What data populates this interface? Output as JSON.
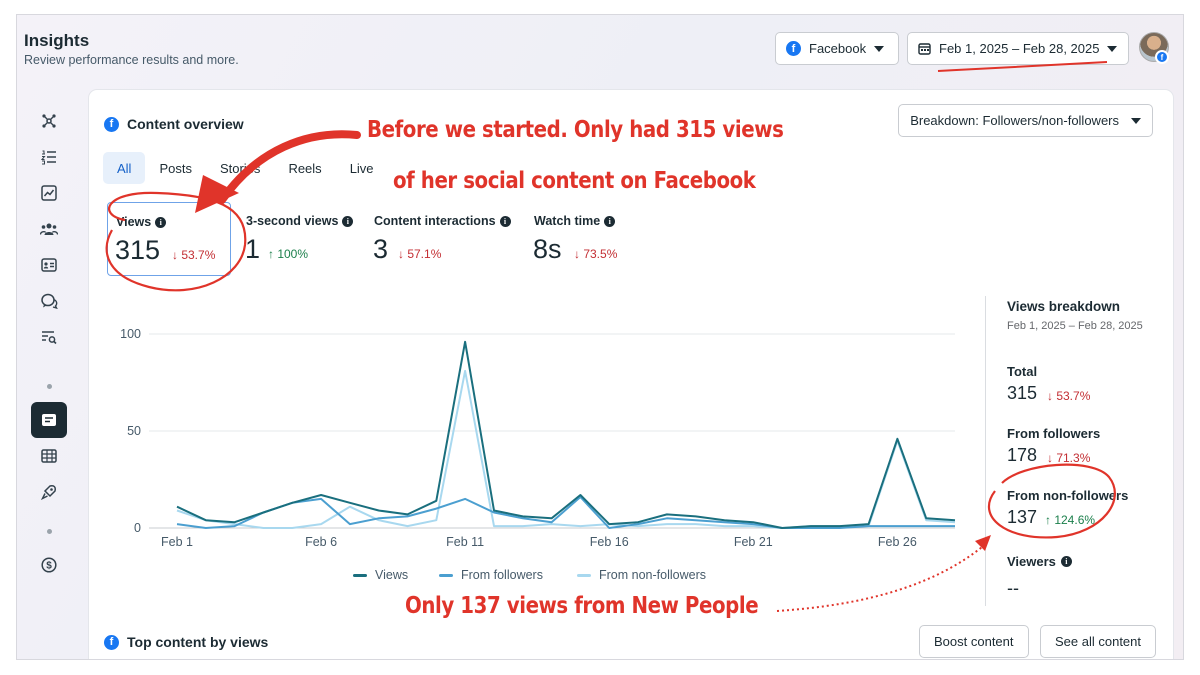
{
  "header": {
    "title": "Insights",
    "subtitle": "Review performance results and more.",
    "platform_label": "Facebook",
    "date_range_label": "Feb 1, 2025 – Feb 28, 2025"
  },
  "content_overview": {
    "title": "Content overview",
    "breakdown_label": "Breakdown: Followers/non-followers",
    "tabs": [
      "All",
      "Posts",
      "Stories",
      "Reels",
      "Live"
    ],
    "metrics": [
      {
        "label": "Views",
        "value": "315",
        "delta": "↓ 53.7%",
        "direction": "down"
      },
      {
        "label": "3-second views",
        "value": "1",
        "delta": "↑ 100%",
        "direction": "up"
      },
      {
        "label": "Content interactions",
        "value": "3",
        "delta": "↓ 57.1%",
        "direction": "down"
      },
      {
        "label": "Watch time",
        "value": "8s",
        "delta": "↓ 73.5%",
        "direction": "down"
      }
    ],
    "legend": [
      "Views",
      "From followers",
      "From non-followers"
    ]
  },
  "chart_data": {
    "type": "line",
    "x": [
      "Feb 1",
      "Feb 2",
      "Feb 3",
      "Feb 4",
      "Feb 5",
      "Feb 6",
      "Feb 7",
      "Feb 8",
      "Feb 9",
      "Feb 10",
      "Feb 11",
      "Feb 12",
      "Feb 13",
      "Feb 14",
      "Feb 15",
      "Feb 16",
      "Feb 17",
      "Feb 18",
      "Feb 19",
      "Feb 20",
      "Feb 21",
      "Feb 22",
      "Feb 23",
      "Feb 24",
      "Feb 25",
      "Feb 26",
      "Feb 27",
      "Feb 28"
    ],
    "x_tick_labels": [
      "Feb 1",
      "Feb 6",
      "Feb 11",
      "Feb 16",
      "Feb 21",
      "Feb 26"
    ],
    "y_ticks": [
      "0",
      "50",
      "100"
    ],
    "ylim": [
      0,
      100
    ],
    "grid": true,
    "series": [
      {
        "name": "Views",
        "color": "#1a6f7e",
        "values": [
          11,
          4,
          3,
          8,
          13,
          17,
          13,
          9,
          7,
          14,
          96,
          9,
          6,
          5,
          17,
          2,
          3,
          7,
          6,
          4,
          3,
          0,
          1,
          1,
          2,
          46,
          5,
          4
        ]
      },
      {
        "name": "From followers",
        "color": "#4b9fd0",
        "values": [
          2,
          0,
          1,
          8,
          13,
          15,
          2,
          5,
          6,
          10,
          15,
          8,
          5,
          3,
          16,
          0,
          2,
          5,
          4,
          3,
          2,
          0,
          0,
          0,
          1,
          1,
          1,
          1
        ]
      },
      {
        "name": "From non-followers",
        "color": "#a8d8ef",
        "values": [
          9,
          4,
          2,
          0,
          0,
          2,
          11,
          4,
          1,
          4,
          81,
          1,
          1,
          2,
          1,
          2,
          1,
          2,
          2,
          1,
          1,
          0,
          1,
          1,
          1,
          45,
          4,
          3
        ]
      }
    ]
  },
  "views_breakdown": {
    "title": "Views breakdown",
    "date_range": "Feb 1, 2025 – Feb 28, 2025",
    "items": [
      {
        "label": "Total",
        "value": "315",
        "delta": "↓ 53.7%",
        "direction": "down"
      },
      {
        "label": "From followers",
        "value": "178",
        "delta": "↓ 71.3%",
        "direction": "down"
      },
      {
        "label": "From non-followers",
        "value": "137",
        "delta": "↑ 124.6%",
        "direction": "up"
      },
      {
        "label": "Viewers",
        "value": "--",
        "delta": "",
        "direction": ""
      }
    ]
  },
  "top_content": {
    "title": "Top content by views",
    "boost_label": "Boost content",
    "see_all_label": "See all content"
  },
  "annotations": {
    "top_line1": "Before we started. Only had 315 views",
    "top_line2": "of her social content on Facebook",
    "bottom": "Only 137 views from New People",
    "color": "#e0342a"
  }
}
